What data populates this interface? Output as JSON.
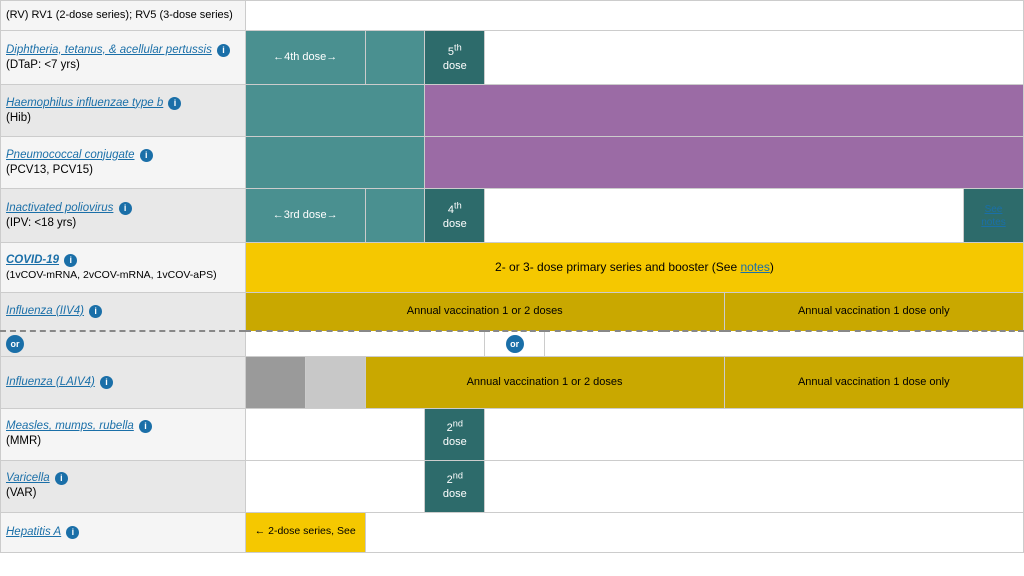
{
  "vaccines": [
    {
      "id": "rv",
      "name": "(RV) RV1 (2-dose series); RV5 (3-dose series)",
      "nameIsLink": false,
      "sub": "",
      "rowClass": "top-partial",
      "cells": [
        {
          "span": 14,
          "text": "",
          "color": "white-cell"
        }
      ]
    },
    {
      "id": "dtap",
      "name": "Diphtheria, tetanus, & acellular pertussis",
      "nameIsLink": true,
      "sub": "(DTaP: <7 yrs)",
      "rowClass": "normal-row",
      "hasInfo": true
    },
    {
      "id": "hib",
      "name": "Haemophilus influenzae type b",
      "nameIsLink": true,
      "sub": "(Hib)",
      "rowClass": "normal-row",
      "hasInfo": true
    },
    {
      "id": "pcv",
      "name": "Pneumococcal conjugate",
      "nameIsLink": true,
      "sub": "(PCV13, PCV15)",
      "rowClass": "normal-row",
      "hasInfo": true
    },
    {
      "id": "ipv",
      "name": "Inactivated poliovirus",
      "nameIsLink": true,
      "sub": "(IPV: <18 yrs)",
      "rowClass": "normal-row",
      "hasInfo": true
    },
    {
      "id": "covid",
      "name": "COVID-19",
      "nameIsLink": true,
      "sub": "(1vCOV-mRNA, 2vCOV-mRNA, 1vCOV-aPS)",
      "rowClass": "covid-row",
      "hasInfo": true
    },
    {
      "id": "iiv4",
      "name": "Influenza (IIV4)",
      "nameIsLink": true,
      "sub": "",
      "rowClass": "influenza-row",
      "hasInfo": true
    },
    {
      "id": "or-row",
      "isOrRow": true
    },
    {
      "id": "laiv4",
      "name": "Influenza (LAIV4)",
      "nameIsLink": true,
      "sub": "",
      "rowClass": "laiv-row",
      "hasInfo": true
    },
    {
      "id": "mmr",
      "name": "Measles, mumps, rubella",
      "nameIsLink": true,
      "sub": "(MMR)",
      "rowClass": "mmr-row",
      "hasInfo": true
    },
    {
      "id": "varicella",
      "name": "Varicella",
      "nameIsLink": true,
      "sub": "(VAR)",
      "rowClass": "varicella-row",
      "hasInfo": true
    },
    {
      "id": "hepa",
      "name": "Hepatitis A",
      "nameIsLink": true,
      "sub": "",
      "rowClass": "hepa-row",
      "hasInfo": true
    }
  ],
  "labels": {
    "4th_dose": "←4th dose→",
    "5th_dose_super": "th",
    "5th_dose": "5",
    "dose": "dose",
    "3rd_dose": "←3rd dose→",
    "4th_dose_label": "4",
    "4th_super": "th",
    "covid_text": "2- or 3- dose primary series and booster (See ",
    "covid_notes": "notes",
    "covid_text2": ")",
    "annual_1_2": "Annual vaccination 1 or 2 doses",
    "annual_1_only": "Annual vaccination 1 dose only",
    "annual_1_2_laiv": "Annual vaccination 1 or 2 doses",
    "annual_1_only_laiv": "Annual vaccination 1 dose only",
    "2nd_dose": "2",
    "2nd_super": "nd",
    "2dose_series": "← 2-dose series, See",
    "see_notes": "See notes",
    "see_notes_ipv": "See\nnotes"
  }
}
